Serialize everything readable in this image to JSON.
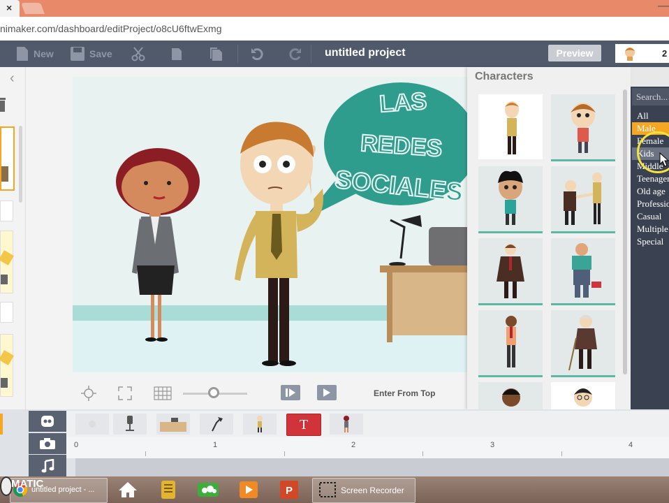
{
  "browser": {
    "tab_close": "×",
    "url": "nimaker.com/dashboard/editProject/o8cU6ftwExmg"
  },
  "toolbar": {
    "new_label": "New",
    "save_label": "Save",
    "project_title": "untitled project",
    "preview_label": "Preview",
    "user_count": "2"
  },
  "stage": {
    "bubble_line1": "LAS",
    "bubble_line2": "REDES",
    "bubble_line3": "SOCIALES"
  },
  "controls": {
    "enter_label": "Enter From Top"
  },
  "characters": {
    "title": "Characters",
    "search_placeholder": "Search...",
    "filters": [
      "All",
      "Male",
      "Female",
      "Kids",
      "Middle",
      "Teenager",
      "Old age",
      "Professional",
      "Casual",
      "Multiple",
      "Special"
    ]
  },
  "timeline": {
    "ruler": [
      "0",
      "1",
      "2",
      "3",
      "4"
    ],
    "text_item": "T"
  },
  "taskbar": {
    "start_text": "MATIC",
    "project_item": "untitled project - ...",
    "recorder_item": "Screen Recorder"
  },
  "colors": {
    "toolbar": "#505a6b",
    "accent_orange": "#f5a623",
    "teal": "#3aa597",
    "filter_bg": "#3a4252"
  }
}
